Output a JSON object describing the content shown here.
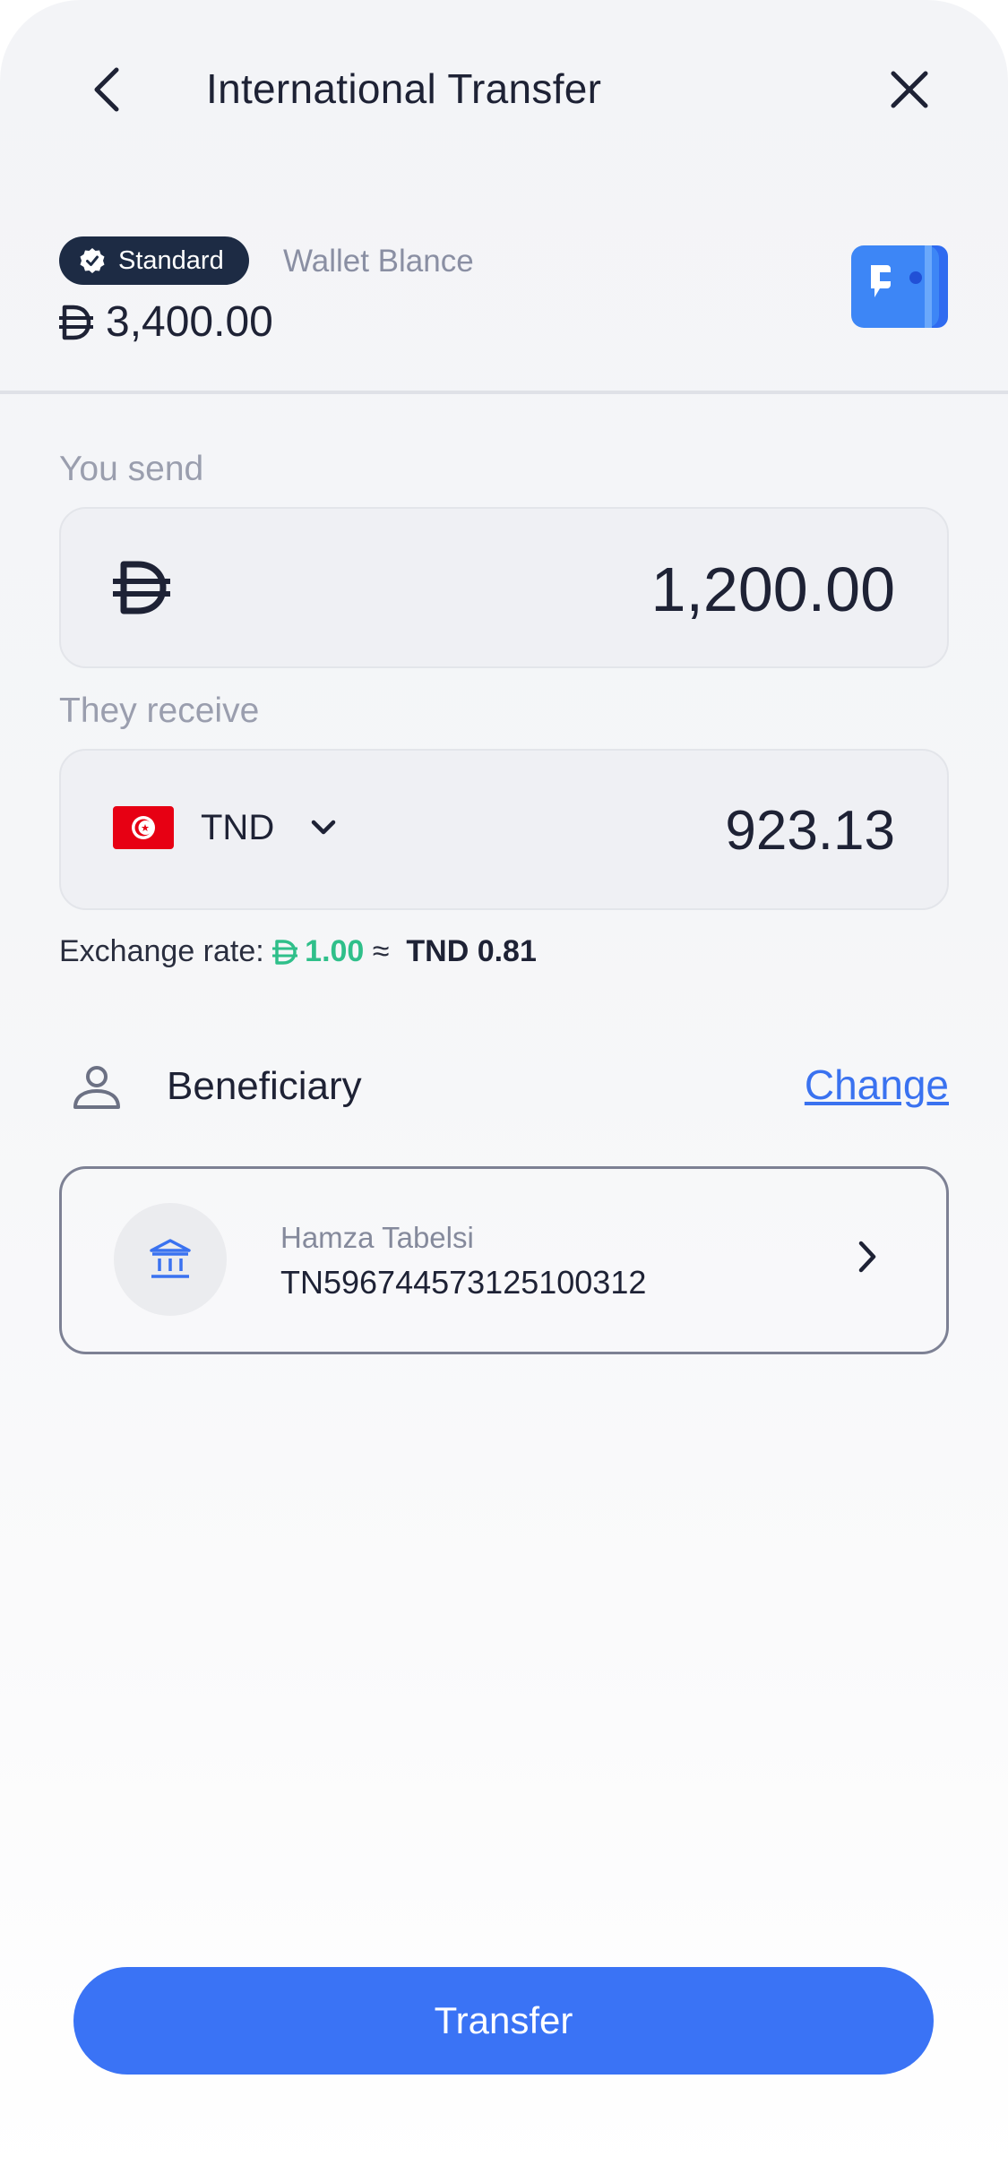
{
  "header": {
    "title": "International Transfer",
    "back_icon": "chevron-left-icon",
    "close_icon": "close-icon"
  },
  "wallet": {
    "badge_label": "Standard",
    "badge_icon": "verified-check-icon",
    "label": "Wallet Blance",
    "currency_symbol": "Đ",
    "balance": "3,400.00",
    "icon": "wallet-icon"
  },
  "send": {
    "label": "You send",
    "currency_symbol": "Đ",
    "amount": "1,200.00"
  },
  "receive": {
    "label": "They receive",
    "currency": "TND",
    "flag": "tunisia-flag-icon",
    "amount": "923.13"
  },
  "exchange": {
    "prefix": "Exchange rate:",
    "from_symbol": "Đ",
    "from_value": "1.00",
    "approx": "≈",
    "to_value": "TND 0.81"
  },
  "beneficiary": {
    "title": "Beneficiary",
    "change_label": "Change",
    "name": "Hamza Tabelsi",
    "iban": "TN596744573125100312",
    "icon": "bank-icon"
  },
  "actions": {
    "transfer_label": "Transfer"
  },
  "colors": {
    "primary": "#3a73f5",
    "badge": "#1d2b44",
    "rate_green": "#2fbf8a",
    "flag_red": "#e70013"
  }
}
